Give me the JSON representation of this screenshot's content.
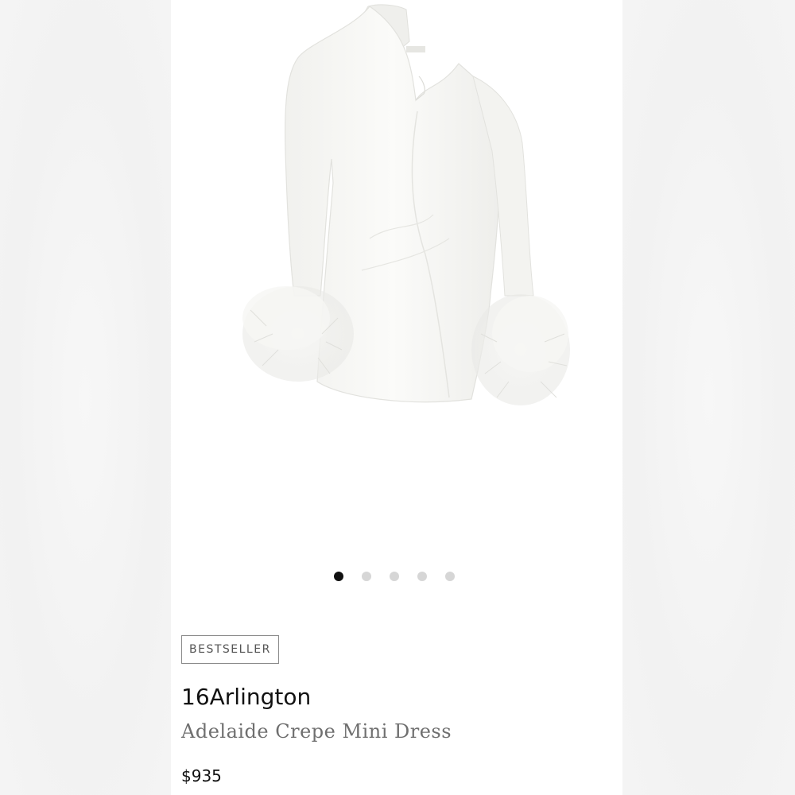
{
  "product": {
    "badge": "BESTSELLER",
    "brand": "16Arlington",
    "name": "Adelaide Crepe Mini Dress",
    "price": "$935"
  },
  "carousel": {
    "total": 5,
    "active_index": 0
  },
  "image": {
    "icon": "dress-image"
  }
}
